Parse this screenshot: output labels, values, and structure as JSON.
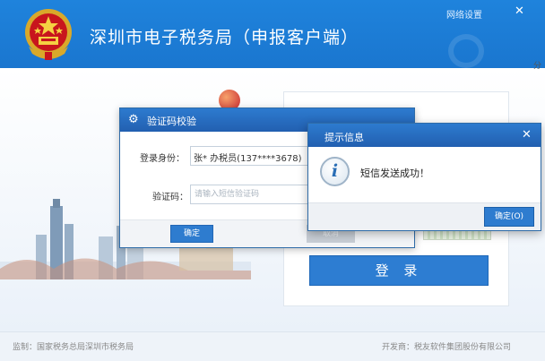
{
  "app": {
    "title": "深圳市电子税务局（申报客户端）",
    "network_settings": "网络设置",
    "close": "✕",
    "edge_labels": [
      "分",
      "X"
    ]
  },
  "footer": {
    "supervisor": "监制：国家税务总局深圳市税务局",
    "developer": "开发商：税友软件集团股份有限公司"
  },
  "login": {
    "button_label": "登 录"
  },
  "verify_dialog": {
    "title": "验证码校验",
    "identity_label": "登录身份：",
    "identity_value": "张* 办税员(137****3678)",
    "code_label": "验证码：",
    "code_placeholder": "请输入短信验证码",
    "code_value": "",
    "ok_label": "确定",
    "cancel_label": "取消"
  },
  "info_dialog": {
    "title": "提示信息",
    "close": "✕",
    "message": "短信发送成功！",
    "ok_label": "确定(O)"
  },
  "colors": {
    "header_blue": "#1f83dc",
    "dialog_title_blue": "#2d7bcf",
    "button_blue": "#2e7ccf"
  }
}
